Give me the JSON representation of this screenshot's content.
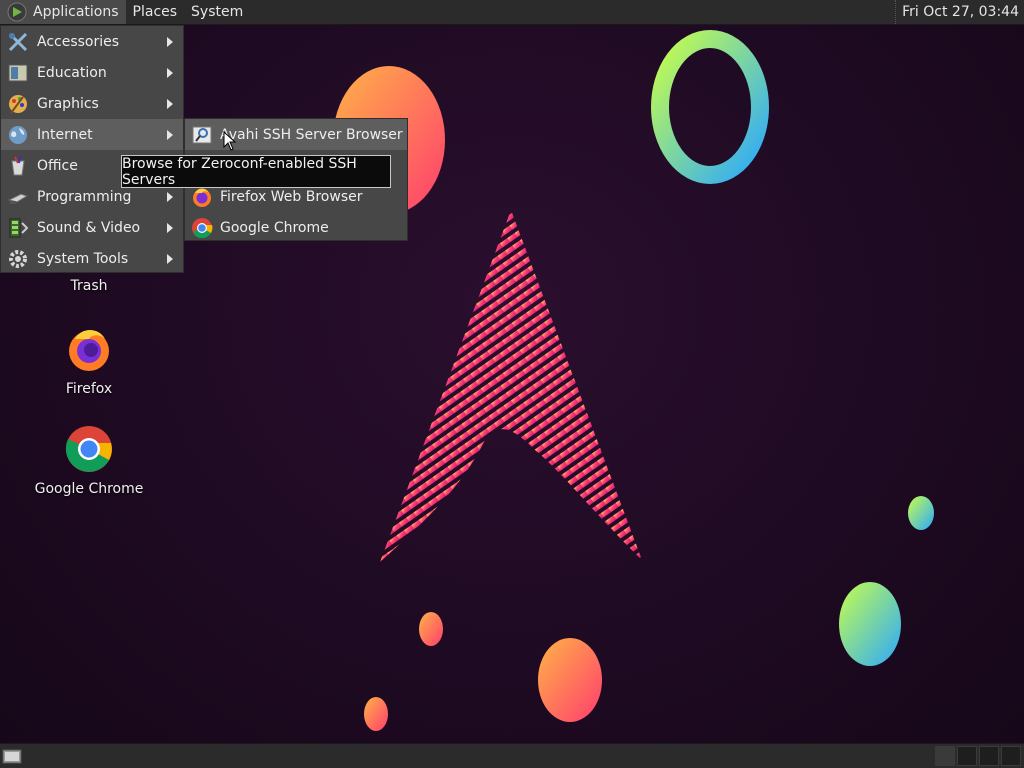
{
  "top_panel": {
    "menus": [
      {
        "label": "Applications",
        "active": true
      },
      {
        "label": "Places"
      },
      {
        "label": "System"
      }
    ],
    "clock": "Fri Oct 27, 03:44"
  },
  "desktop_icons": [
    {
      "label": "Trash",
      "icon": "trash-icon"
    },
    {
      "label": "Firefox",
      "icon": "firefox-icon"
    },
    {
      "label": "Google Chrome",
      "icon": "chrome-icon"
    }
  ],
  "applications_menu": {
    "items": [
      {
        "label": "Accessories",
        "icon": "accessories-icon"
      },
      {
        "label": "Education",
        "icon": "education-icon"
      },
      {
        "label": "Graphics",
        "icon": "graphics-icon"
      },
      {
        "label": "Internet",
        "icon": "internet-icon",
        "active": true
      },
      {
        "label": "Office",
        "icon": "office-icon"
      },
      {
        "label": "Programming",
        "icon": "programming-icon"
      },
      {
        "label": "Sound & Video",
        "icon": "sound-video-icon"
      },
      {
        "label": "System Tools",
        "icon": "system-tools-icon"
      }
    ]
  },
  "internet_submenu": {
    "items": [
      {
        "label": "Avahi SSH Server Browser",
        "icon": "avahi-ssh-icon",
        "active": true
      },
      {
        "label": "",
        "icon": ""
      },
      {
        "label": "Firefox Web Browser",
        "icon": "firefox-icon"
      },
      {
        "label": "Google Chrome",
        "icon": "chrome-icon"
      }
    ]
  },
  "tooltip": "Browse for Zeroconf-enabled SSH Servers",
  "colors": {
    "panel": "#2b2b2b",
    "menu_bg": "#474747",
    "menu_active": "#5e5e5e",
    "desktop_bg": "#1e0a22"
  }
}
